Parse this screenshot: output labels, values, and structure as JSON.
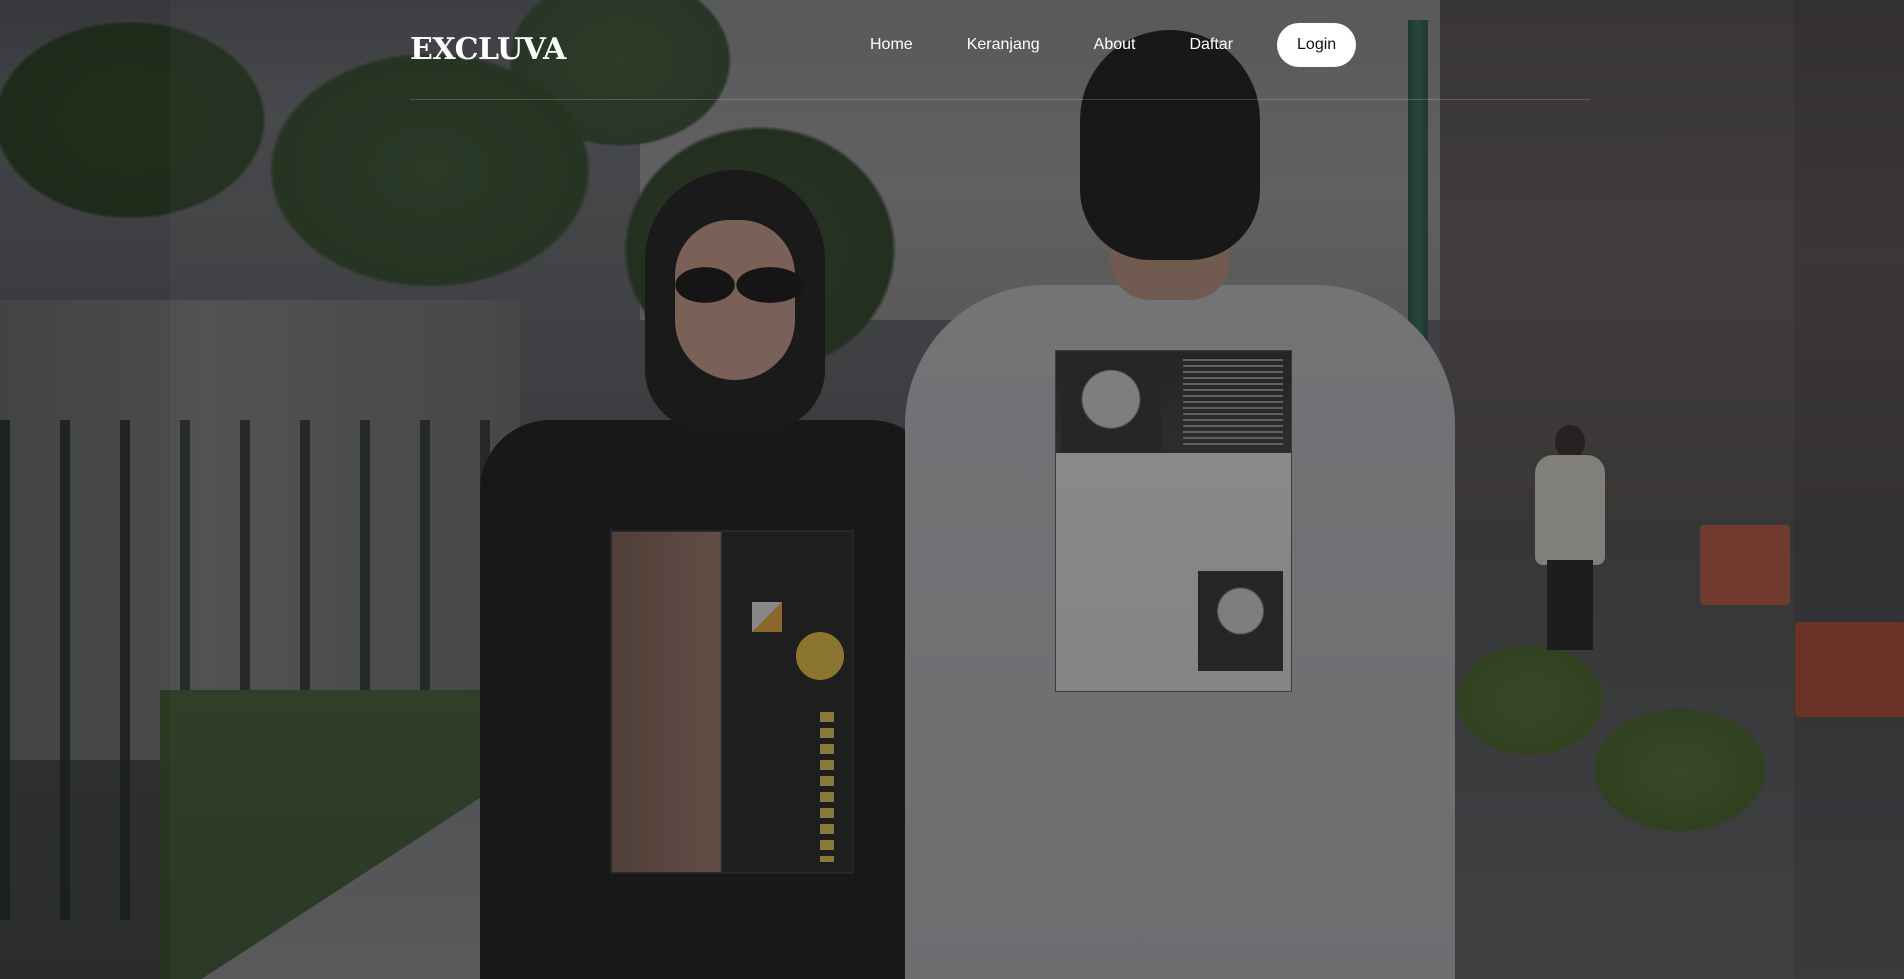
{
  "brand": {
    "name": "EXCLUVA"
  },
  "nav": {
    "links": [
      {
        "label": "Home"
      },
      {
        "label": "Keranjang"
      },
      {
        "label": "About"
      },
      {
        "label": "Daftar"
      }
    ],
    "login_label": "Login"
  },
  "hero": {
    "image": "photo of two people on a tree-lined sidewalk, one in a black graphic t-shirt, one in a white graphic t-shirt seen from the back",
    "overlay_color": "#121214"
  },
  "colors": {
    "nav_text": "#ffffff",
    "login_bg": "#ffffff",
    "login_text": "#111111"
  }
}
